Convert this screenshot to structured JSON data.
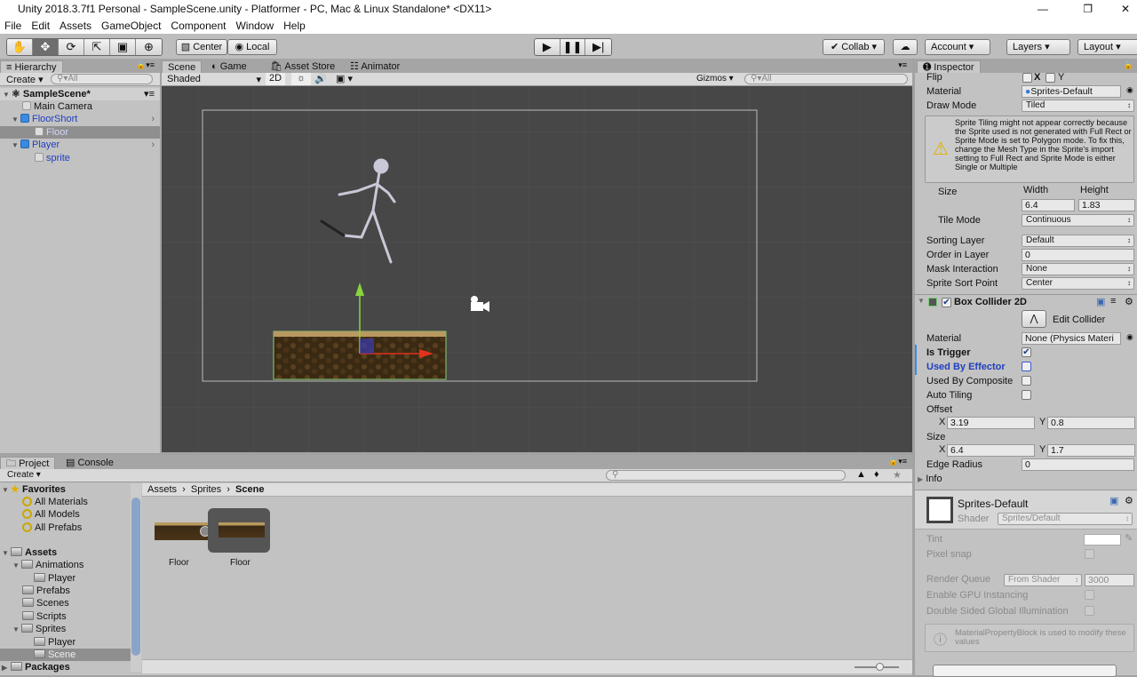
{
  "window": {
    "title": "Unity 2018.3.7f1 Personal - SampleScene.unity - Platformer - PC, Mac & Linux Standalone* <DX11>"
  },
  "menu": [
    "File",
    "Edit",
    "Assets",
    "GameObject",
    "Component",
    "Window",
    "Help"
  ],
  "toolbar": {
    "tools": [
      "hand-tool",
      "move-tool",
      "rotate-tool",
      "scale-tool",
      "rect-tool",
      "transform-tool"
    ],
    "center": "Center",
    "local": "Local",
    "collab": "Collab",
    "account": "Account",
    "layers": "Layers",
    "layout": "Layout"
  },
  "hierarchy": {
    "tab": "Hierarchy",
    "create": "Create",
    "search_placeholder": "All",
    "scene": "SampleScene*",
    "items": [
      {
        "label": "Main Camera"
      },
      {
        "label": "FloorShort"
      },
      {
        "label": "Floor"
      },
      {
        "label": "Player"
      },
      {
        "label": "sprite"
      }
    ]
  },
  "scene": {
    "tabs": [
      "Scene",
      "Game",
      "Asset Store",
      "Animator"
    ],
    "shading": "Shaded",
    "mode2d": "2D",
    "gizmos": "Gizmos",
    "search_placeholder": "All"
  },
  "project": {
    "tabs": [
      "Project",
      "Console"
    ],
    "create": "Create",
    "favorites": "Favorites",
    "fav_items": [
      "All Materials",
      "All Models",
      "All Prefabs"
    ],
    "assets": "Assets",
    "tree": [
      "Animations",
      "Player",
      "Prefabs",
      "Scenes",
      "Scripts",
      "Sprites",
      "Player",
      "Scene"
    ],
    "packages": "Packages",
    "breadcrumb": [
      "Assets",
      "Sprites",
      "Scene"
    ],
    "files": [
      "Floor",
      "Floor"
    ]
  },
  "inspector": {
    "tab": "Inspector",
    "flip": {
      "label": "Flip",
      "x": "X",
      "y": "Y"
    },
    "material": {
      "label": "Material",
      "value": "Sprites-Default"
    },
    "draw_mode": {
      "label": "Draw Mode",
      "value": "Tiled"
    },
    "warning": "Sprite Tiling might not appear correctly because the Sprite used is not generated with Full Rect or Sprite Mode is set to Polygon mode. To fix this, change the Mesh Type in the Sprite's import setting to Full Rect and Sprite Mode is either Single or Multiple",
    "size": {
      "label": "Size",
      "width_label": "Width",
      "height_label": "Height",
      "width": "6.4",
      "height": "1.83"
    },
    "tile_mode": {
      "label": "Tile Mode",
      "value": "Continuous"
    },
    "sorting_layer": {
      "label": "Sorting Layer",
      "value": "Default"
    },
    "order": {
      "label": "Order in Layer",
      "value": "0"
    },
    "mask": {
      "label": "Mask Interaction",
      "value": "None"
    },
    "sort_point": {
      "label": "Sprite Sort Point",
      "value": "Center"
    },
    "box": {
      "title": "Box Collider 2D",
      "edit": "Edit Collider",
      "material_label": "Material",
      "material": "None (Physics Materi",
      "is_trigger": "Is Trigger",
      "is_trigger_checked": true,
      "effector": "Used By Effector",
      "composite": "Used By Composite",
      "auto_tiling": "Auto Tiling",
      "offset": "Offset",
      "offset_x": "3.19",
      "offset_y": "0.8",
      "size": "Size",
      "size_x": "6.4",
      "size_y": "1.7",
      "x": "X",
      "y": "Y",
      "edge_radius": "Edge Radius",
      "edge_radius_value": "0",
      "info": "Info"
    },
    "mat": {
      "name": "Sprites-Default",
      "shader_label": "Shader",
      "shader": "Sprites/Default",
      "tint": "Tint",
      "pixel_snap": "Pixel snap",
      "render_queue": "Render Queue",
      "rq_mode": "From Shader",
      "rq_value": "3000",
      "gpu": "Enable GPU Instancing",
      "double_sided": "Double Sided Global Illumination",
      "note": "MaterialPropertyBlock is used to modify these values"
    }
  },
  "colors": {
    "scene_bg": "#474747",
    "selected": "#8f8f8f",
    "link_blue": "#1f3fc0",
    "x_axis": "#e0321c",
    "y_axis": "#8ad53a"
  }
}
